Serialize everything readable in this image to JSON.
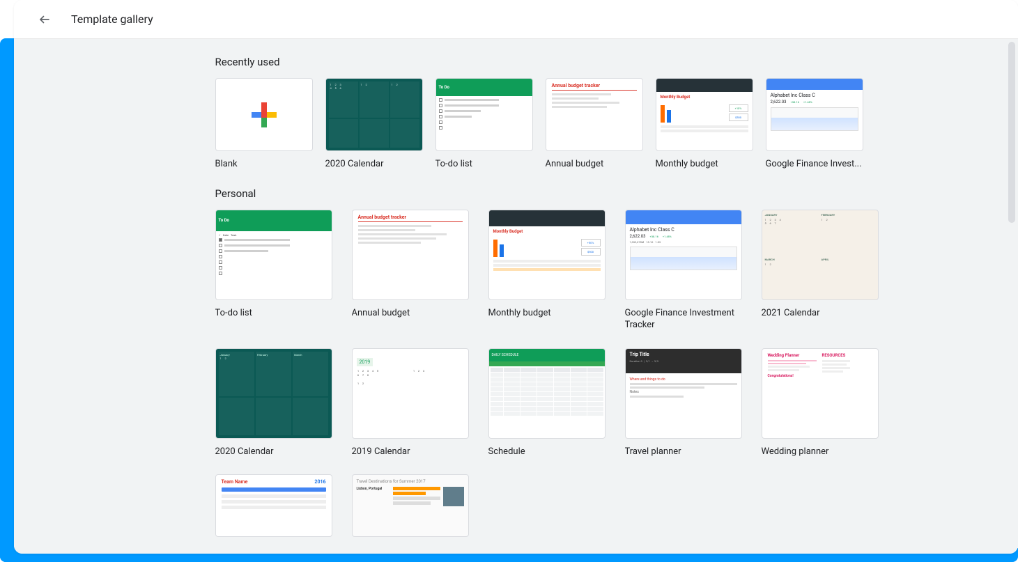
{
  "header": {
    "title": "Template gallery"
  },
  "sections": {
    "recent": {
      "title": "Recently used",
      "items": [
        {
          "label": "Blank"
        },
        {
          "label": "2020 Calendar"
        },
        {
          "label": "To-do list"
        },
        {
          "label": "Annual budget"
        },
        {
          "label": "Monthly budget"
        },
        {
          "label": "Google Finance Invest..."
        }
      ]
    },
    "personal": {
      "title": "Personal",
      "row1": [
        {
          "label": "To-do list"
        },
        {
          "label": "Annual budget"
        },
        {
          "label": "Monthly budget"
        },
        {
          "label": "Google Finance Investment Tracker"
        },
        {
          "label": "2021 Calendar"
        }
      ],
      "row2": [
        {
          "label": "2020 Calendar"
        },
        {
          "label": "2019 Calendar"
        },
        {
          "label": "Schedule"
        },
        {
          "label": "Travel planner"
        },
        {
          "label": "Wedding planner"
        }
      ],
      "row3": [
        {
          "label": ""
        },
        {
          "label": ""
        }
      ]
    }
  },
  "thumbs": {
    "todo_header": "To Do",
    "annual_title": "Annual budget tracker",
    "monthly_title": "Monthly Budget",
    "monthly_stat1": "+10%",
    "monthly_stat2": "$500",
    "finance_name": "Alphabet Inc Class C",
    "finance_price": "2,622.03",
    "finance_delta1": "+38.16",
    "finance_delta2": "+1.48%",
    "cal2019_year": "2019",
    "schedule_header": "DAILY SCHEDULE",
    "travel_title": "Trip Title",
    "wedding_col1": "Wedding Planner",
    "wedding_col2": "RESOURCES",
    "team_name": "Team Name",
    "team_year": "2016",
    "dest_title": "Travel Destinations for Summer 2017",
    "dest_place": "Lisbon, Portugal"
  }
}
